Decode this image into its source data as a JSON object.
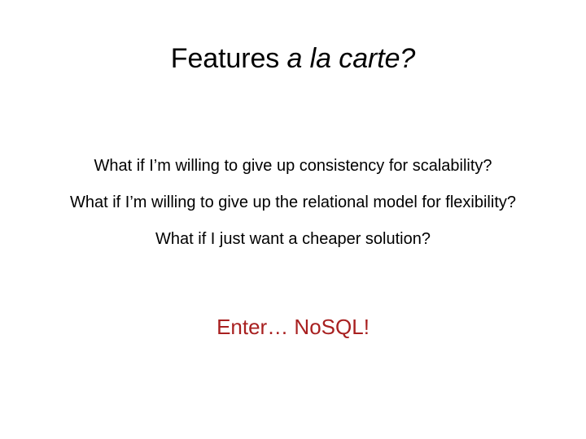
{
  "slide": {
    "background_color": "#ffffff",
    "title": {
      "lead": "Features ",
      "emphasis": "a la carte?",
      "full_text": "Features a la carte?",
      "color": "#000000"
    },
    "body_lines": [
      "What if I’m willing to give up consistency for scalability?",
      "What if I’m willing to give up the relational model for flexibility?",
      "What if I just want a cheaper solution?"
    ],
    "punchline": {
      "text": "Enter… NoSQL!",
      "color": "#a82020"
    }
  }
}
